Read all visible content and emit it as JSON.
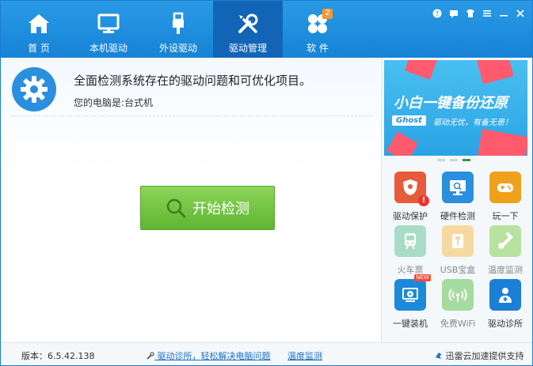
{
  "nav": {
    "items": [
      {
        "label": "首 页",
        "icon": "home-icon",
        "active": false
      },
      {
        "label": "本机驱动",
        "icon": "monitor-icon",
        "active": false
      },
      {
        "label": "外设驱动",
        "icon": "usb-plug-icon",
        "active": false
      },
      {
        "label": "驱动管理",
        "icon": "tools-icon",
        "active": true
      },
      {
        "label": "软 件",
        "icon": "clover-apps-icon",
        "active": false
      }
    ],
    "software_badge": "2"
  },
  "window_controls": [
    "help-icon",
    "feedback-icon",
    "shirt-skin-icon",
    "menu-icon",
    "minimize-icon",
    "close-icon"
  ],
  "main": {
    "headline": "全面检测系统存在的驱动问题和可优化项目。",
    "subline": "您的电脑是:台式机",
    "scan_button": "开始检测"
  },
  "banner": {
    "title": "小白一键备份还原",
    "ghost": "Ghost",
    "tagline": "驱动无忧，有备无患！"
  },
  "tools": [
    {
      "label": "驱动保护",
      "icon": "shield-icon",
      "color": "#e85a3c",
      "muted": false
    },
    {
      "label": "硬件检测",
      "icon": "screen-search-icon",
      "color": "#2a8fde",
      "muted": false
    },
    {
      "label": "玩一下",
      "icon": "gamepad-icon",
      "color": "#f0a11c",
      "muted": false
    },
    {
      "label": "火车票",
      "icon": "train-icon",
      "color": "#a8dcc6",
      "muted": true
    },
    {
      "label": "USB宝盒",
      "icon": "usb-box-icon",
      "color": "#f6d9a0",
      "muted": true
    },
    {
      "label": "温度监测",
      "icon": "thermometer-icon",
      "color": "#b8e2a0",
      "muted": true
    },
    {
      "label": "一键装机",
      "icon": "disc-install-icon",
      "color": "#1b8ad8",
      "muted": false,
      "new": "NEW"
    },
    {
      "label": "免费WiFi",
      "icon": "wifi-icon",
      "color": "#a6dba0",
      "muted": true
    },
    {
      "label": "驱动诊所",
      "icon": "doctor-icon",
      "color": "#1b7fd6",
      "muted": false
    }
  ],
  "status": {
    "version": "版本：6.5.42.138",
    "link1": "驱动诊所，轻松解决电脑问题",
    "link2": "温度监测",
    "right": "迅雷云加速提供支持"
  }
}
